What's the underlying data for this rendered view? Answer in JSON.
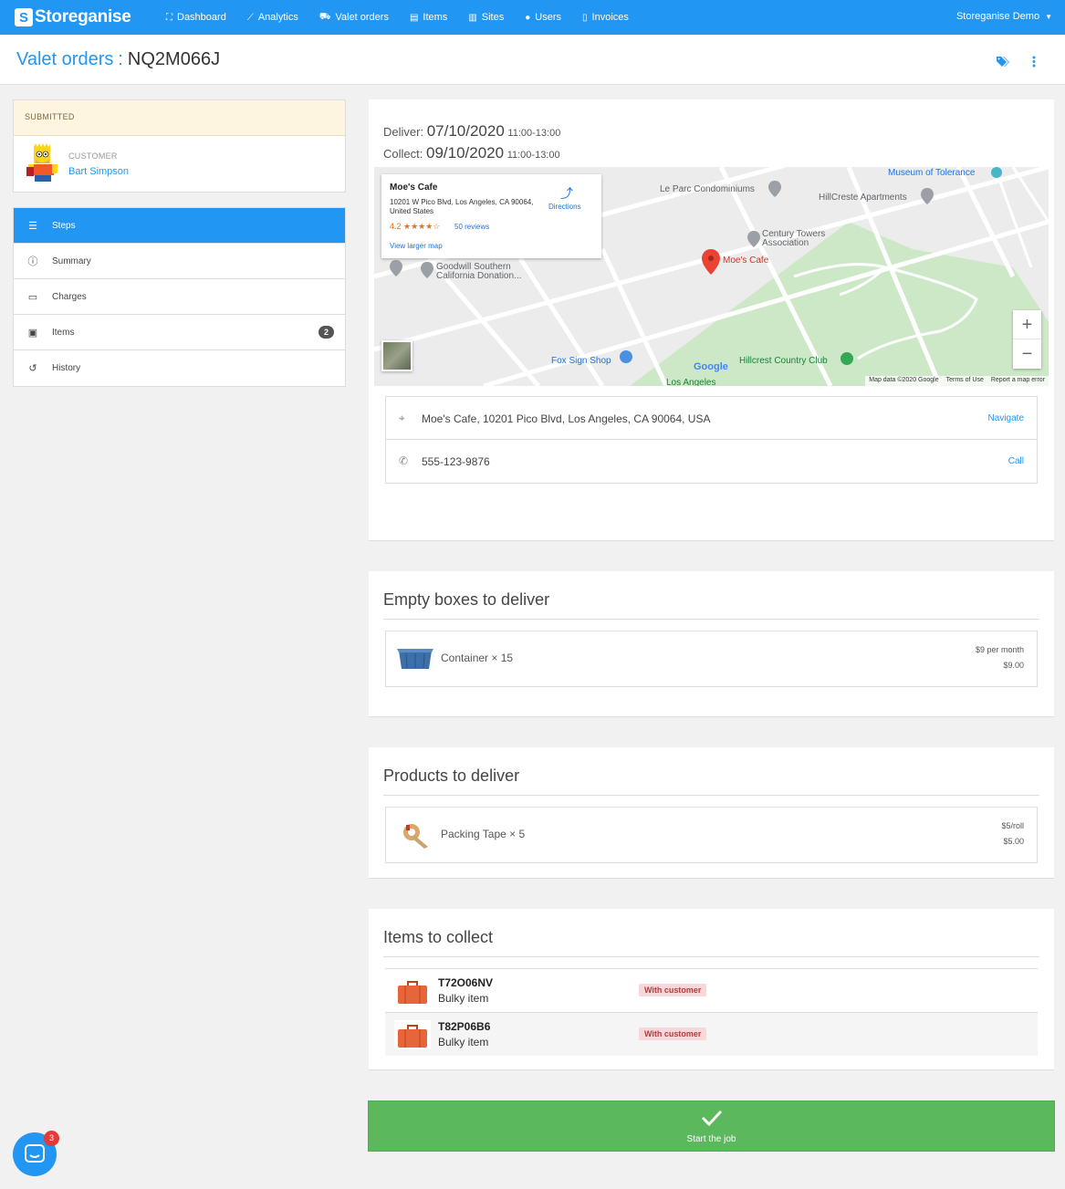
{
  "brand": {
    "logo_letter": "S",
    "name": "Storeganise"
  },
  "nav": {
    "items": [
      {
        "icon": "sitemap-icon",
        "glyph": "⛶",
        "label": "Dashboard"
      },
      {
        "icon": "chart-icon",
        "glyph": "⟋",
        "label": "Analytics"
      },
      {
        "icon": "truck-icon",
        "glyph": "⛟",
        "label": "Valet orders"
      },
      {
        "icon": "box-icon",
        "glyph": "▤",
        "label": "Items"
      },
      {
        "icon": "building-icon",
        "glyph": "▥",
        "label": "Sites"
      },
      {
        "icon": "user-icon",
        "glyph": "●",
        "label": "Users"
      },
      {
        "icon": "file-icon",
        "glyph": "▯",
        "label": "Invoices"
      }
    ],
    "user_menu": "Storeganise Demo"
  },
  "header": {
    "crumb": "Valet orders",
    "separator": ":",
    "order_ref": "NQ2M066J"
  },
  "status": "SUBMITTED",
  "customer": {
    "label": "CUSTOMER",
    "name": "Bart Simpson"
  },
  "side_menu": [
    {
      "label": "Steps",
      "icon": "steps-icon",
      "glyph": "☰"
    },
    {
      "label": "Summary",
      "icon": "info-icon",
      "glyph": "ⓘ"
    },
    {
      "label": "Charges",
      "icon": "money-icon",
      "glyph": "▭"
    },
    {
      "label": "Items",
      "icon": "archive-icon",
      "glyph": "▣",
      "badge": "2"
    },
    {
      "label": "History",
      "icon": "history-icon",
      "glyph": "↺"
    }
  ],
  "schedule": {
    "deliver_label": "Deliver:",
    "deliver_date": "07/10/2020",
    "deliver_time": "11:00-13:00",
    "collect_label": "Collect:",
    "collect_date": "09/10/2020",
    "collect_time": "11:00-13:00"
  },
  "map": {
    "place_name": "Moe's Cafe",
    "place_address": "10201 W Pico Blvd, Los Angeles, CA 90064, United States",
    "rating": "4.2 ★★★★☆",
    "reviews": "50 reviews",
    "view_larger": "View larger map",
    "directions": "Directions",
    "labels": [
      "Le Parc Condominiums",
      "HillCreste Apartments",
      "Museum of Tolerance",
      "Century Towers Association",
      "Moe's Cafe",
      "Goodwill Southern California Donation...",
      "Fox Sign Shop",
      "Hillcrest Country Club",
      "Los Angeles"
    ],
    "google": "Google",
    "footer": [
      "Map data ©2020 Google",
      "Terms of Use",
      "Report a map error"
    ],
    "zoom_in": "+",
    "zoom_out": "−"
  },
  "address": {
    "text": "Moe's Cafe, 10201 Pico Blvd, Los Angeles, CA 90064, USA",
    "action": "Navigate"
  },
  "phone": {
    "text": "555-123-9876",
    "action": "Call"
  },
  "empty_boxes": {
    "title": "Empty boxes to deliver",
    "items": [
      {
        "name": "Container × 15",
        "unit_price": "$9 per month",
        "total": "$9.00"
      }
    ]
  },
  "products": {
    "title": "Products to deliver",
    "items": [
      {
        "name": "Packing Tape × 5",
        "unit_price": "$5/roll",
        "total": "$5.00"
      }
    ]
  },
  "collect": {
    "title": "Items to collect",
    "items": [
      {
        "id": "T72O06NV",
        "type": "Bulky item",
        "status": "With customer"
      },
      {
        "id": "T82P06B6",
        "type": "Bulky item",
        "status": "With customer"
      }
    ]
  },
  "start_job": {
    "label": "Start the job",
    "icon": "check-icon"
  },
  "chat": {
    "badge": "3"
  },
  "colors": {
    "primary": "#2196f3",
    "success": "#5cb85c",
    "danger_bg": "#f8d7da",
    "submitted_bg": "#fdf5e0"
  }
}
